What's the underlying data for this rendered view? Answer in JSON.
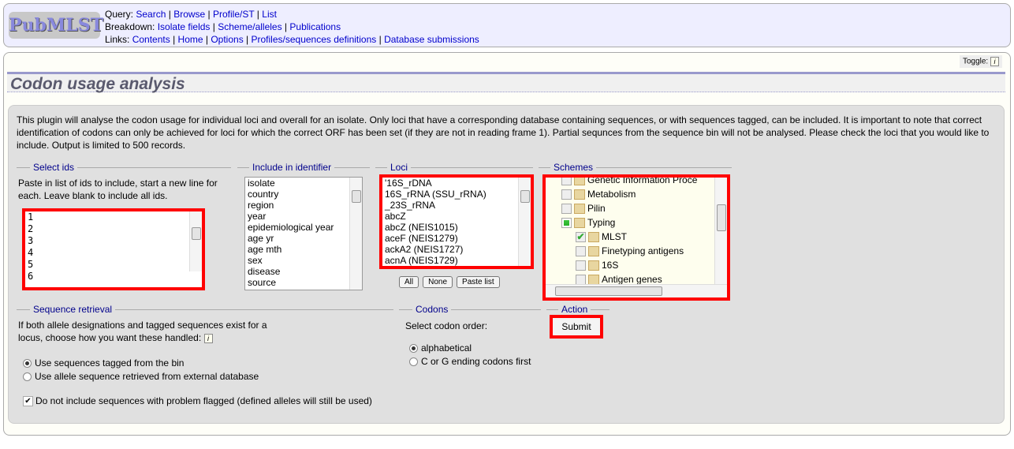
{
  "header": {
    "logo": "PubMLST",
    "query_label": "Query:",
    "query_links": [
      "Search",
      "Browse",
      "Profile/ST",
      "List"
    ],
    "breakdown_label": "Breakdown:",
    "breakdown_links": [
      "Isolate fields",
      "Scheme/alleles",
      "Publications"
    ],
    "links_label": "Links:",
    "links": [
      "Contents",
      "Home",
      "Options",
      "Profiles/sequences definitions",
      "Database submissions"
    ]
  },
  "toggle_label": "Toggle:",
  "page_title": "Codon usage analysis",
  "description": "This plugin will analyse the codon usage for individual loci and overall for an isolate. Only loci that have a corresponding database containing sequences, or with sequences tagged, can be included. It is important to note that correct identification of codons can only be achieved for loci for which the correct ORF has been set (if they are not in reading frame 1). Partial sequnces from the sequence bin will not be analysed. Please check the loci that you would like to include. Output is limited to 500 records.",
  "select_ids": {
    "legend": "Select ids",
    "help": "Paste in list of ids to include, start a new line for each. Leave blank to include all ids.",
    "values": [
      "1",
      "2",
      "3",
      "4",
      "5",
      "6"
    ]
  },
  "identifier": {
    "legend": "Include in identifier",
    "options": [
      "isolate",
      "country",
      "region",
      "year",
      "epidemiological year",
      "age yr",
      "age mth",
      "sex",
      "disease",
      "source"
    ]
  },
  "loci": {
    "legend": "Loci",
    "options": [
      "'16S_rDNA",
      "16S_rRNA (SSU_rRNA)",
      "_23S_rRNA",
      "abcZ",
      "abcZ (NEIS1015)",
      "aceF (NEIS1279)",
      "ackA2 (NEIS1727)",
      "acnA (NEIS1729)"
    ],
    "buttons": {
      "all": "All",
      "none": "None",
      "paste": "Paste list"
    }
  },
  "schemes": {
    "legend": "Schemes",
    "items": [
      {
        "label": "Genetic Information Proce",
        "checked": false,
        "level": 0
      },
      {
        "label": "Metabolism",
        "checked": false,
        "level": 0
      },
      {
        "label": "Pilin",
        "checked": false,
        "level": 0
      },
      {
        "label": "Typing",
        "checked": "partial",
        "level": 0
      },
      {
        "label": "MLST",
        "checked": true,
        "level": 1
      },
      {
        "label": "Finetyping antigens",
        "checked": false,
        "level": 1
      },
      {
        "label": "16S",
        "checked": false,
        "level": 1
      },
      {
        "label": "Antigen genes",
        "checked": false,
        "level": 1
      }
    ]
  },
  "sequence_retrieval": {
    "legend": "Sequence retrieval",
    "help": "If both allele designations and tagged sequences exist for a locus, choose how you want these handled:",
    "options": [
      "Use sequences tagged from the bin",
      "Use allele sequence retrieved from external database"
    ],
    "selected": 0,
    "checkbox_label": "Do not include sequences with problem flagged (defined alleles will still be used)",
    "checkbox_checked": true
  },
  "codons": {
    "legend": "Codons",
    "help": "Select codon order:",
    "options": [
      "alphabetical",
      "C or G ending codons first"
    ],
    "selected": 0
  },
  "action": {
    "legend": "Action",
    "submit": "Submit"
  }
}
